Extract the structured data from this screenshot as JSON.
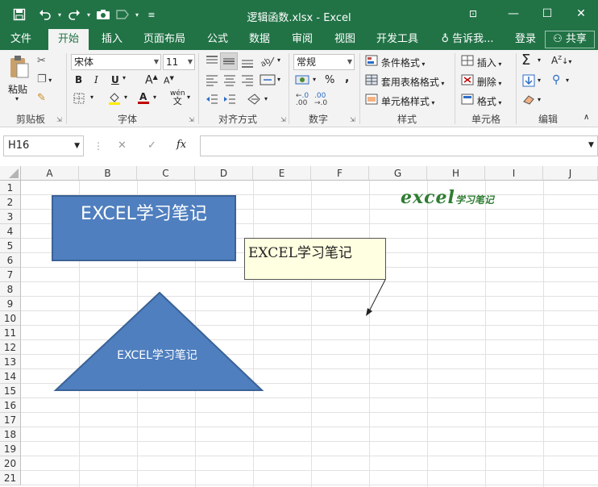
{
  "window": {
    "title": "逻辑函数.xlsx - Excel",
    "min": "—",
    "max": "☐",
    "close": "✕",
    "ribbon_opt": "⊡"
  },
  "tabs": [
    "文件",
    "开始",
    "插入",
    "页面布局",
    "公式",
    "数据",
    "审阅",
    "视图",
    "开发工具"
  ],
  "tell_me": "告诉我...",
  "login": "登录",
  "share": "共享",
  "ribbon": {
    "clipboard": {
      "paste": "粘贴",
      "label": "剪贴板"
    },
    "font": {
      "name": "宋体",
      "size": "11",
      "label": "字体",
      "bold": "B",
      "italic": "I",
      "underline": "U",
      "grow": "A",
      "shrink": "A",
      "wen": "wén"
    },
    "alignment": {
      "label": "对齐方式"
    },
    "number": {
      "format": "常规",
      "label": "数字",
      "percent": "%",
      "comma": ",",
      "inc": ".0",
      "dec": ".00"
    },
    "styles": {
      "label": "样式",
      "conditional": "条件格式",
      "table": "套用表格格式",
      "cell": "单元格样式"
    },
    "cells": {
      "label": "单元格",
      "insert": "插入",
      "delete": "删除",
      "format": "格式"
    },
    "editing": {
      "label": "编辑",
      "sum": "Σ",
      "sort": "A",
      "find": "⚲"
    }
  },
  "formula_bar": {
    "name_box": "H16",
    "cancel": "✕",
    "enter": "✓",
    "fx": "fx"
  },
  "columns": [
    "A",
    "B",
    "C",
    "D",
    "E",
    "F",
    "G",
    "H",
    "I",
    "J"
  ],
  "rows": [
    "1",
    "2",
    "3",
    "4",
    "5",
    "6",
    "7",
    "8",
    "9",
    "10",
    "11",
    "12",
    "13",
    "14",
    "15",
    "16",
    "17",
    "18",
    "19",
    "20",
    "21"
  ],
  "shapes": {
    "rect_text": "EXCEL学习笔记",
    "callout_text": "EXCEL学习笔记",
    "triangle_text": "EXCEL学习笔记"
  },
  "logo": {
    "big": "excel",
    "small": "学习笔记"
  },
  "colors": {
    "brand": "#217346",
    "shape_fill": "#4f7fbf",
    "callout_fill": "#ffffe1"
  }
}
